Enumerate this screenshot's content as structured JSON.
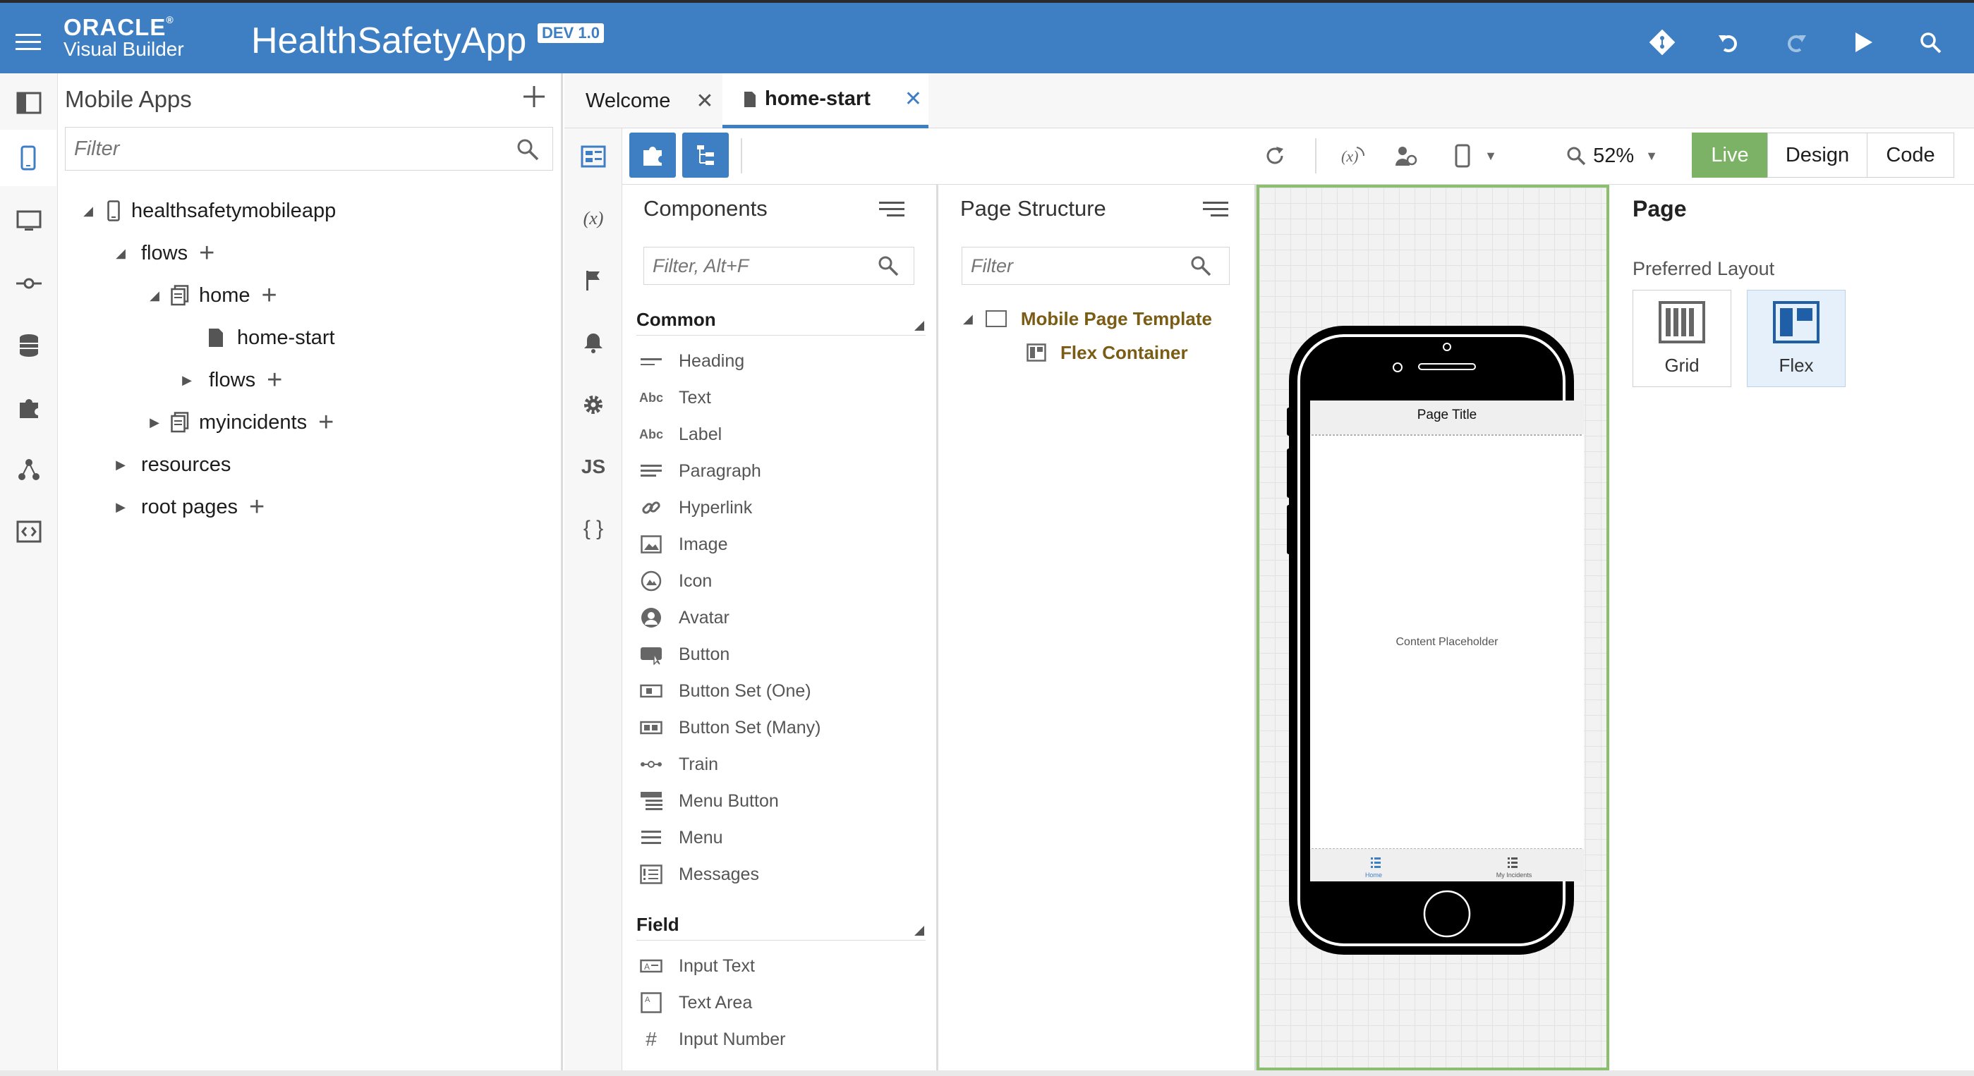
{
  "header": {
    "brand_top": "ORACLE",
    "brand_reg": "®",
    "brand_bottom": "Visual Builder",
    "app_title": "HealthSafetyApp",
    "version_badge": "DEV 1.0",
    "colors": {
      "bar": "#3e7fc4"
    }
  },
  "left_rail": {
    "items": [
      "navigator-toggle-icon",
      "mobile-apps-icon",
      "web-apps-icon",
      "services-icon",
      "business-objects-icon",
      "components-icon",
      "processes-icon",
      "source-view-icon"
    ]
  },
  "navigator": {
    "title": "Mobile Apps",
    "filter_placeholder": "Filter",
    "tree": {
      "app": "healthsafetymobileapp",
      "flows": "flows",
      "home": "home",
      "home_start": "home-start",
      "nested_flows": "flows",
      "myincidents": "myincidents",
      "resources": "resources",
      "root_pages": "root pages"
    }
  },
  "tabs": [
    {
      "label": "Welcome",
      "close": "✕"
    },
    {
      "label": "home-start",
      "close": "✕"
    }
  ],
  "toolbar": {
    "zoom": "52%",
    "modes": {
      "live": "Live",
      "design": "Design",
      "code": "Code"
    },
    "active_mode": "Live",
    "live_color": "#7cb265"
  },
  "tool_rail": {
    "variables_label": "(x)",
    "js_label": "JS",
    "json_label": "{ }"
  },
  "components": {
    "title": "Components",
    "filter_placeholder": "Filter, Alt+F",
    "common_header": "Common",
    "common_items": [
      "Heading",
      "Text",
      "Label",
      "Paragraph",
      "Hyperlink",
      "Image",
      "Icon",
      "Avatar",
      "Button",
      "Button Set (One)",
      "Button Set (Many)",
      "Train",
      "Menu Button",
      "Menu",
      "Messages"
    ],
    "field_header": "Field",
    "field_items": [
      "Input Text",
      "Text Area",
      "Input Number"
    ]
  },
  "structure": {
    "title": "Page Structure",
    "filter_placeholder": "Filter",
    "nodes": [
      "Mobile Page Template",
      "Flex Container"
    ]
  },
  "canvas": {
    "page_title": "Page Title",
    "content_placeholder": "Content Placeholder",
    "nav_home": "Home",
    "nav_incidents": "My Incidents",
    "border_color": "#8bbf6f"
  },
  "properties": {
    "title": "Page",
    "preferred_layout_label": "Preferred Layout",
    "options": {
      "grid": "Grid",
      "flex": "Flex"
    },
    "selected": "Flex"
  }
}
